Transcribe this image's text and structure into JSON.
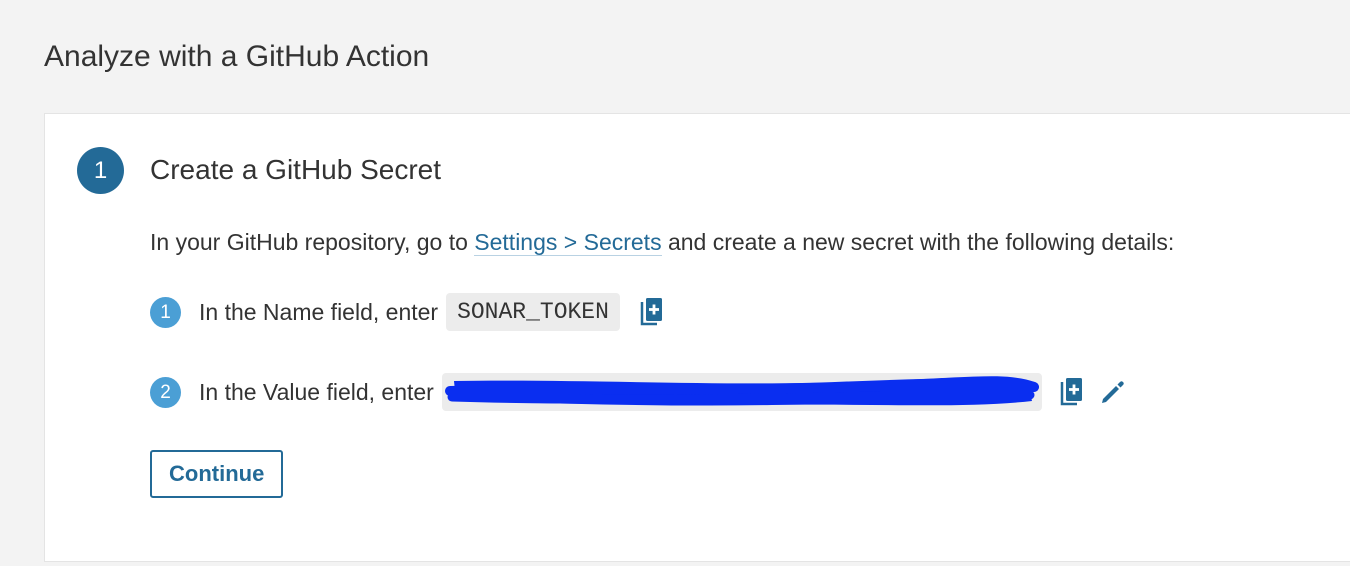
{
  "page": {
    "title": "Analyze with a GitHub Action"
  },
  "step": {
    "number": "1",
    "title": "Create a GitHub Secret",
    "intro_before": "In your GitHub repository, go to ",
    "intro_link": "Settings > Secrets",
    "intro_after": " and create a new secret with the following details:"
  },
  "items": [
    {
      "number": "1",
      "label": "In the Name field, enter",
      "value": "SONAR_TOKEN"
    },
    {
      "number": "2",
      "label": "In the Value field, enter",
      "value": ""
    }
  ],
  "actions": {
    "continue_label": "Continue"
  },
  "icons": {
    "copy": "copy-icon",
    "edit": "pencil-icon"
  },
  "colors": {
    "accent": "#236a97",
    "badge": "#4b9fd5",
    "redaction": "#0a2ef0"
  }
}
